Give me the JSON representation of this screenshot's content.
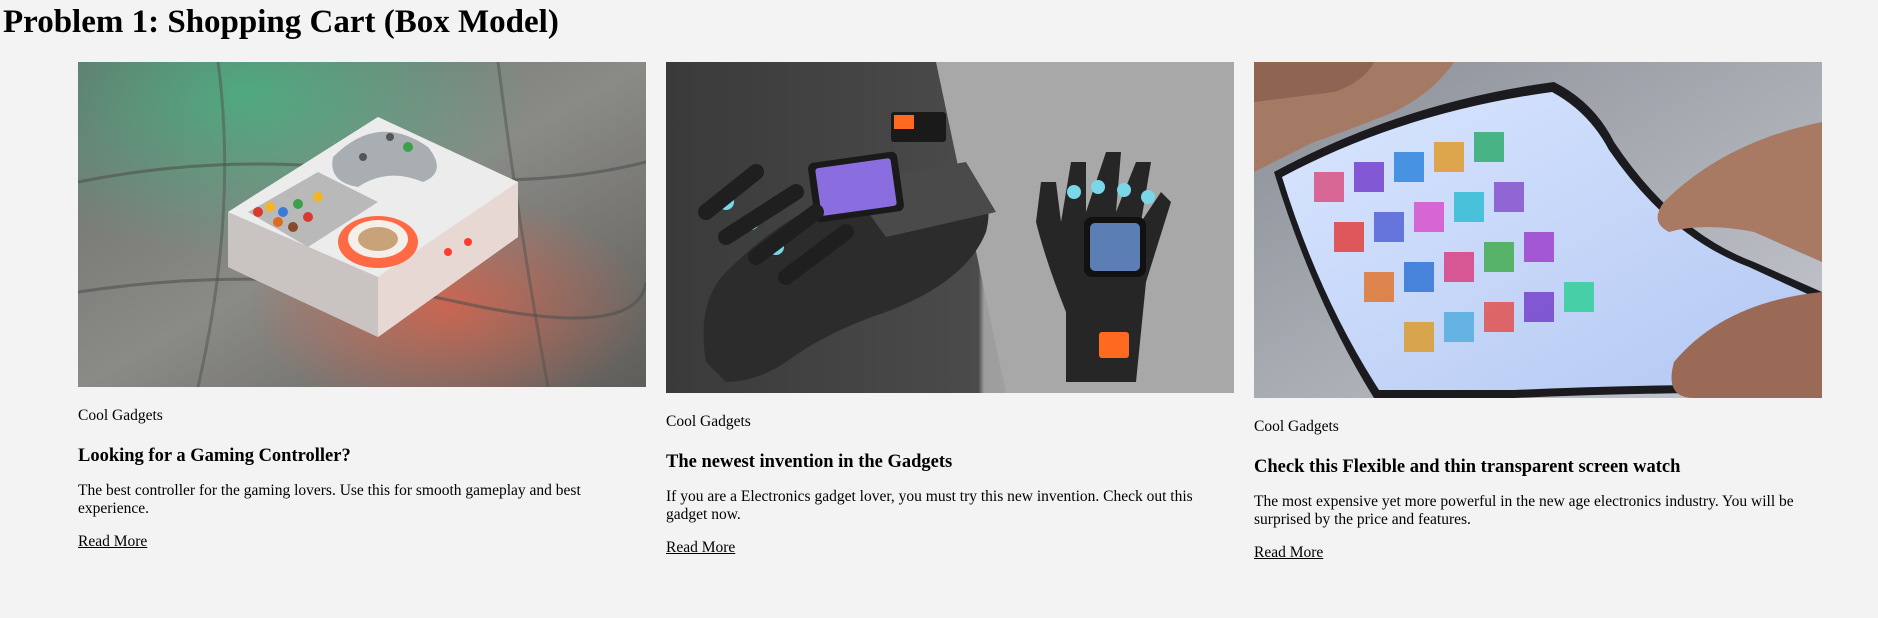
{
  "page": {
    "title": "Problem 1: Shopping Cart (Box Model)"
  },
  "cards": [
    {
      "image_icon": "gaming-tray-image",
      "tag": "Cool Gadgets",
      "title": "Looking for a Gaming Controller?",
      "description": "The best controller for the gaming lovers. Use this for smooth gameplay and best experience.",
      "link": "Read More"
    },
    {
      "image_icon": "smart-glove-image",
      "tag": "Cool Gadgets",
      "title": "The newest invention in the Gadgets",
      "description": "If you are a Electronics gadget lover, you must try this new invention. Check out this gadget now.",
      "link": "Read More"
    },
    {
      "image_icon": "flexible-screen-image",
      "tag": "Cool Gadgets",
      "title": "Check this Flexible and thin transparent screen watch",
      "description": "The most expensive yet more powerful in the new age electronics industry. You will be surprised by the price and features.",
      "link": "Read More"
    }
  ],
  "colors": {
    "background": "#f3f3f3",
    "text": "#000000"
  }
}
